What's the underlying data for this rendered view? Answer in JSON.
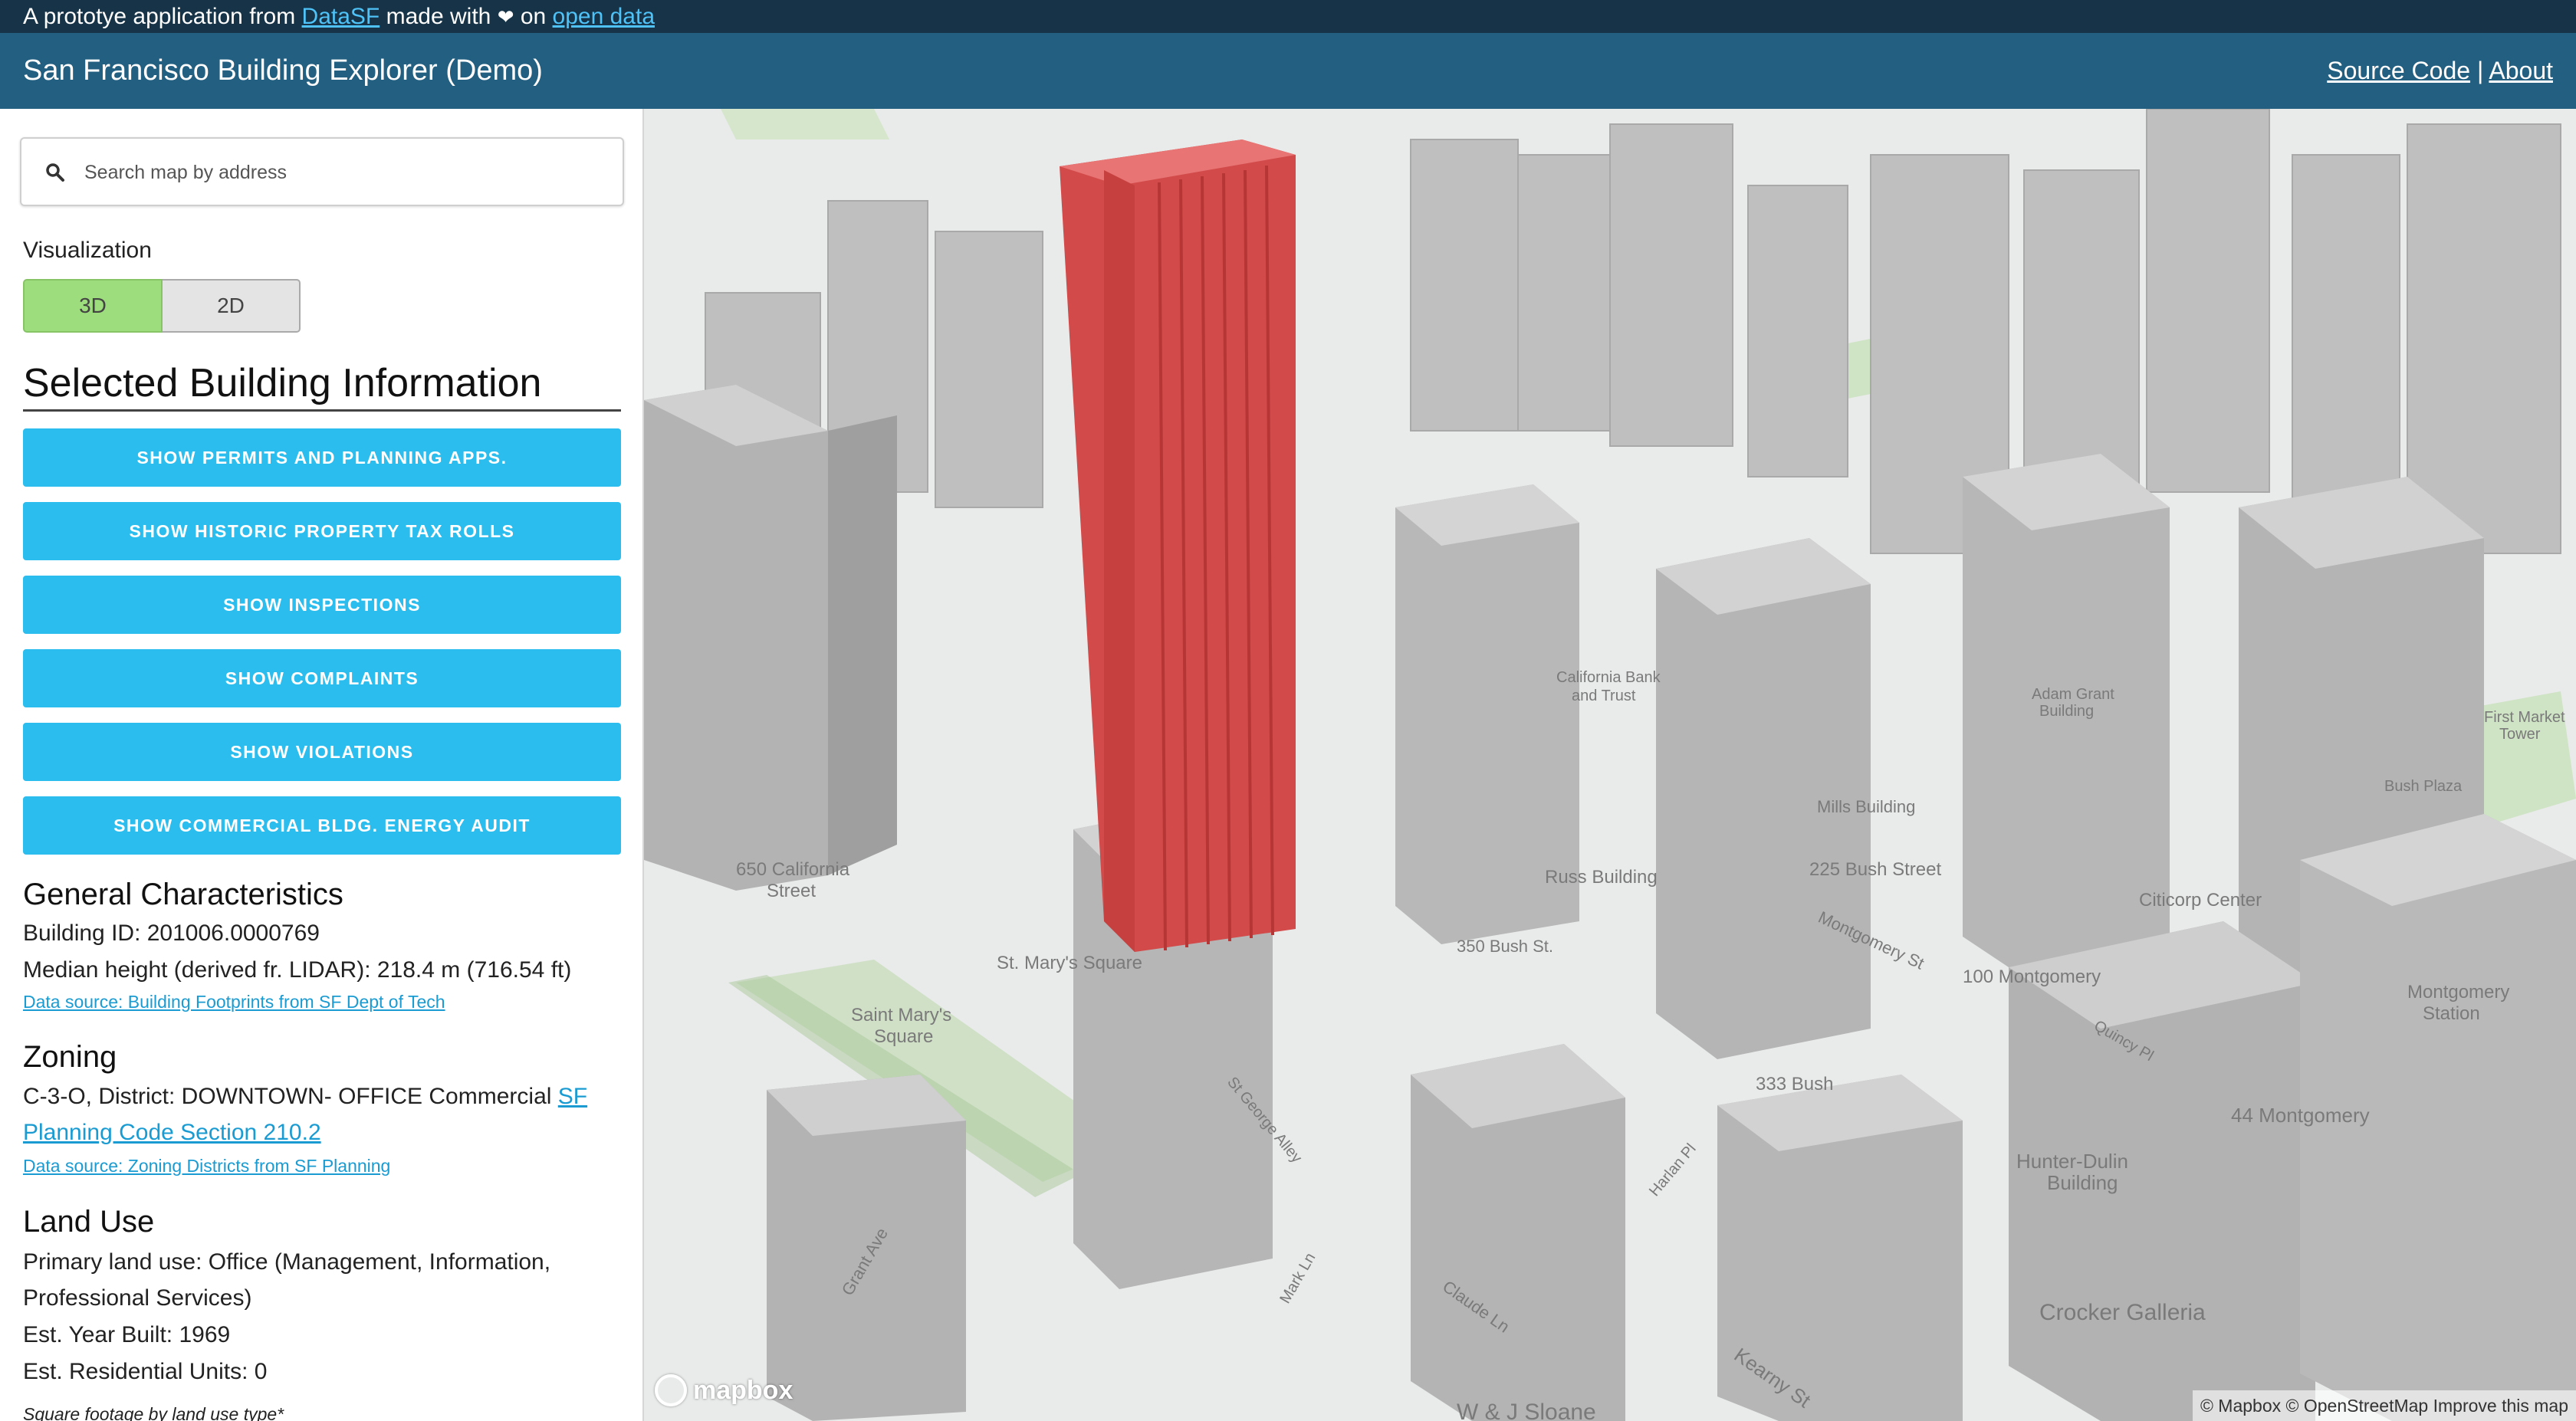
{
  "topbar": {
    "prefix": "A prototye application from",
    "datasf_link": "DataSF",
    "made_with": "made with",
    "on_text": "on",
    "open_data_link": "open data"
  },
  "header": {
    "title": "San Francisco Building Explorer (Demo)",
    "source_code_link": "Source Code",
    "separator": "|",
    "about_link": "About"
  },
  "sidebar": {
    "search_placeholder": "Search map by address",
    "visualization_label": "Visualization",
    "toggle_3d": "3D",
    "toggle_2d": "2D",
    "selected_title": "Selected Building Information",
    "buttons": [
      "SHOW PERMITS AND PLANNING APPS.",
      "SHOW HISTORIC PROPERTY TAX ROLLS",
      "SHOW INSPECTIONS",
      "SHOW COMPLAINTS",
      "SHOW VIOLATIONS",
      "SHOW COMMERCIAL BLDG. ENERGY AUDIT"
    ],
    "general": {
      "heading": "General Characteristics",
      "building_id": "Building ID: 201006.0000769",
      "height": "Median height (derived fr. LIDAR): 218.4 m (716.54 ft)",
      "source": "Data source: Building Footprints from SF Dept of Tech"
    },
    "zoning": {
      "heading": "Zoning",
      "text": "C-3-O, District: DOWNTOWN- OFFICE Commercial",
      "code_link": "SF Planning Code Section 210.2",
      "source": "Data source: Zoning Districts from SF Planning"
    },
    "land_use": {
      "heading": "Land Use",
      "primary": "Primary land use: Office (Management, Information, Professional Services)",
      "year_built": "Est. Year Built: 1969",
      "residential_units": "Est. Residential Units: 0",
      "cutoff": "Square footage by land use type*"
    }
  },
  "map": {
    "labels": [
      "650 California Street",
      "St. Mary's Square",
      "Saint Mary's Square",
      "California Bank and Trust",
      "Mills Building",
      "Russ Building",
      "225 Bush Street",
      "350 Bush St.",
      "Citicorp Center",
      "100 Montgomery",
      "Montgomery Station",
      "333 Bush",
      "44 Montgomery",
      "Hunter-Dulin Building",
      "Crocker Galleria",
      "Adam Grant Building",
      "First Market Tower",
      "Bush Plaza",
      "Grant Ave",
      "Claude Ln",
      "Kearny St",
      "W & J Sloane",
      "Montgomery St",
      "Quincy Pl",
      "St George Alley",
      "Mark Ln",
      "Harlan Pl"
    ],
    "attribution": "© Mapbox © OpenStreetMap Improve this map",
    "logo": "mapbox",
    "highlight_color": "#e05252",
    "building_color": "#bdbdbd"
  }
}
